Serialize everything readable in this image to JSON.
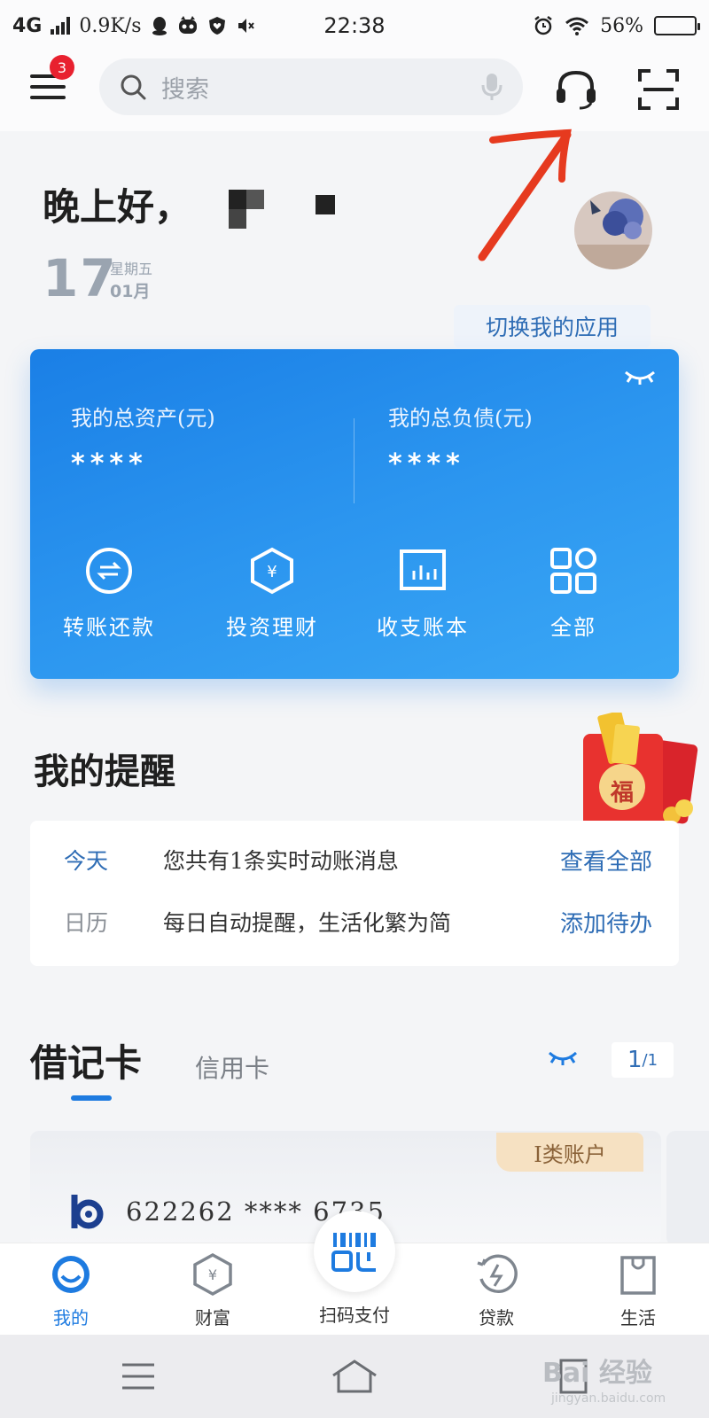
{
  "status_bar": {
    "network": "4G",
    "speed": "0.9K/s",
    "time": "22:38",
    "battery_percent": "56%",
    "battery_level": 0.56
  },
  "header": {
    "menu_badge": "3",
    "search_placeholder": "搜索"
  },
  "greeting": {
    "text": "晚上好，",
    "day": "17",
    "weekday": "星期五",
    "month": "01月"
  },
  "switch_app_label": "切换我的应用",
  "assets": {
    "total_assets_label": "我的总资产(元)",
    "total_assets_value": "****",
    "total_liabilities_label": "我的总负债(元)",
    "total_liabilities_value": "****",
    "quick_actions": [
      {
        "label": "转账还款",
        "icon": "transfer-icon"
      },
      {
        "label": "投资理财",
        "icon": "invest-icon"
      },
      {
        "label": "收支账本",
        "icon": "ledger-icon"
      },
      {
        "label": "全部",
        "icon": "all-apps-icon"
      }
    ]
  },
  "reminders": {
    "title": "我的提醒",
    "promo_text": "福",
    "rows": [
      {
        "tag": "今天",
        "text": "您共有1条实时动账消息",
        "link": "查看全部",
        "tag_color": "#2f6db5"
      },
      {
        "tag": "日历",
        "text": "每日自动提醒，生活化繁为简",
        "link": "添加待办",
        "tag_color": "#8a8f96"
      }
    ]
  },
  "cards": {
    "tab_debit": "借记卡",
    "tab_credit": "信用卡",
    "page_current": "1",
    "page_total": "/1",
    "account_type": "Ⅰ类账户",
    "card_number": "622262 **** 6735"
  },
  "bottom_nav": {
    "items": [
      {
        "label": "我的",
        "icon": "my-icon",
        "active": true
      },
      {
        "label": "财富",
        "icon": "wealth-icon",
        "active": false
      },
      {
        "label": "扫码支付",
        "icon": "scan-pay-icon",
        "active": false
      },
      {
        "label": "贷款",
        "icon": "loan-icon",
        "active": false
      },
      {
        "label": "生活",
        "icon": "life-icon",
        "active": false
      }
    ]
  },
  "watermark": {
    "brand": "Bai 经验",
    "url": "jingyan.baidu.com"
  },
  "colors": {
    "accent": "#1e7be0",
    "card_gradient_start": "#1a7fe6",
    "card_gradient_end": "#3aa7f5",
    "badge": "#e8212f",
    "annotation_arrow": "#e63a1f"
  }
}
